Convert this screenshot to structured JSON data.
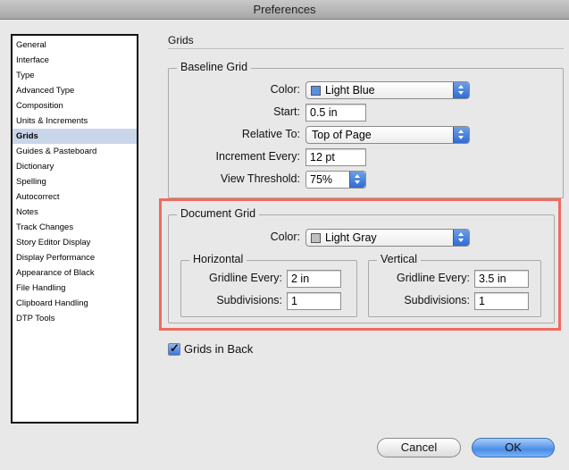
{
  "window": {
    "title": "Preferences"
  },
  "sidebar": {
    "items": [
      {
        "label": "General"
      },
      {
        "label": "Interface"
      },
      {
        "label": "Type"
      },
      {
        "label": "Advanced Type"
      },
      {
        "label": "Composition"
      },
      {
        "label": "Units & Increments"
      },
      {
        "label": "Grids",
        "selected": true
      },
      {
        "label": "Guides & Pasteboard"
      },
      {
        "label": "Dictionary"
      },
      {
        "label": "Spelling"
      },
      {
        "label": "Autocorrect"
      },
      {
        "label": "Notes"
      },
      {
        "label": "Track Changes"
      },
      {
        "label": "Story Editor Display"
      },
      {
        "label": "Display Performance"
      },
      {
        "label": "Appearance of Black"
      },
      {
        "label": "File Handling"
      },
      {
        "label": "Clipboard Handling"
      },
      {
        "label": "DTP Tools"
      }
    ]
  },
  "main": {
    "title": "Grids",
    "baseline": {
      "legend": "Baseline Grid",
      "color_label": "Color:",
      "color_value": "Light Blue",
      "color_swatch": "#5b8fe0",
      "start_label": "Start:",
      "start_value": "0.5 in",
      "relative_label": "Relative To:",
      "relative_value": "Top of Page",
      "increment_label": "Increment Every:",
      "increment_value": "12 pt",
      "threshold_label": "View Threshold:",
      "threshold_value": "75%"
    },
    "document": {
      "legend": "Document Grid",
      "color_label": "Color:",
      "color_value": "Light Gray",
      "color_swatch": "#c0c0c0",
      "horizontal": {
        "legend": "Horizontal",
        "gridline_label": "Gridline Every:",
        "gridline_value": "2 in",
        "subdivisions_label": "Subdivisions:",
        "subdivisions_value": "1"
      },
      "vertical": {
        "legend": "Vertical",
        "gridline_label": "Gridline Every:",
        "gridline_value": "3.5 in",
        "subdivisions_label": "Subdivisions:",
        "subdivisions_value": "1"
      }
    },
    "grids_in_back": {
      "label": "Grids in Back",
      "checked": true
    }
  },
  "buttons": {
    "cancel": "Cancel",
    "ok": "OK"
  },
  "colors": {
    "highlight": "#ef6a5f",
    "accent": "#3f77d6",
    "selection": "#c9d6ea"
  }
}
